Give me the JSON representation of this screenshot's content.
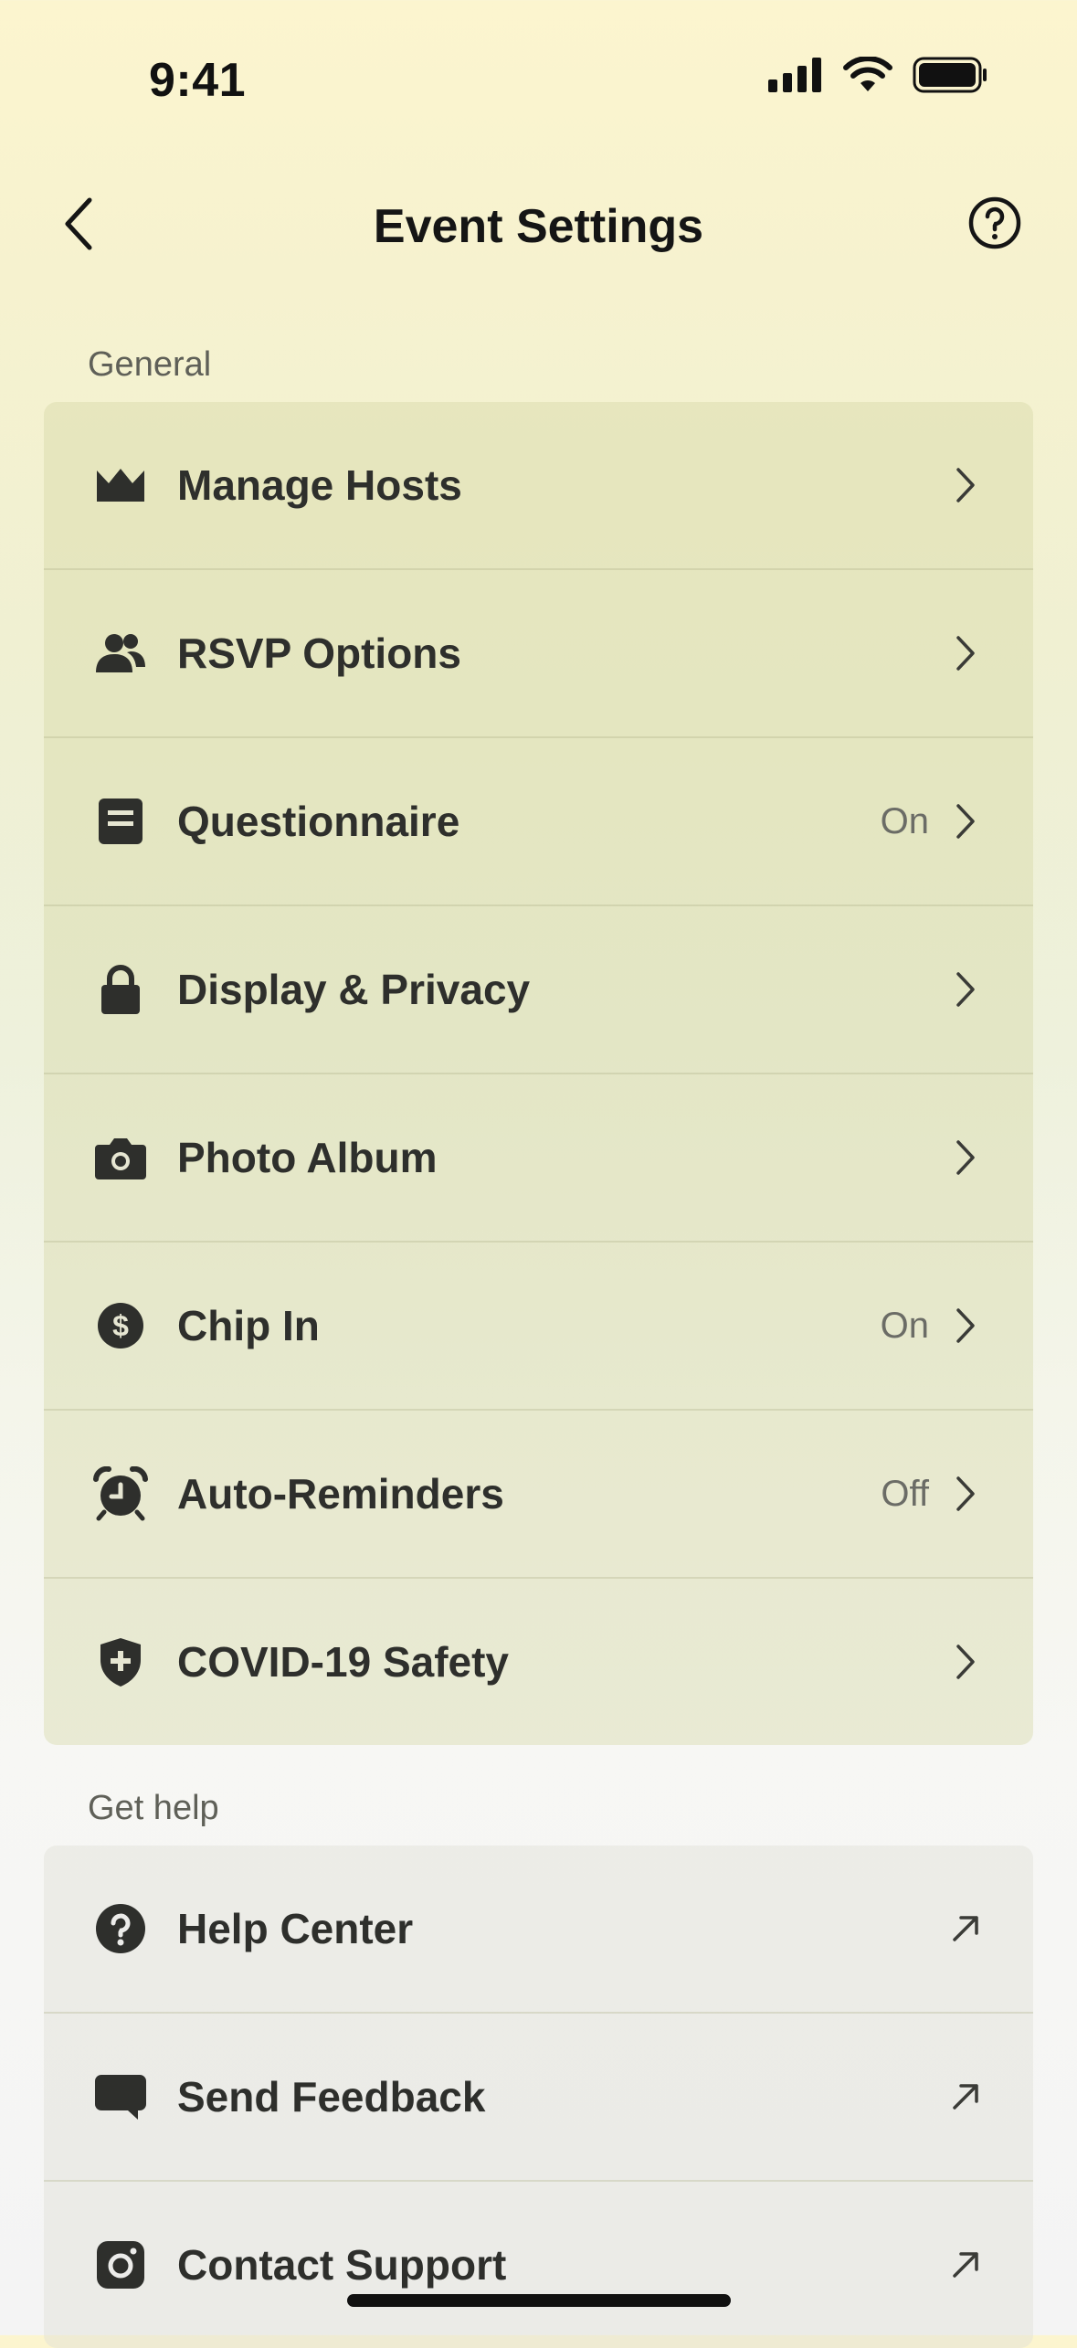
{
  "status_bar": {
    "time": "9:41"
  },
  "nav": {
    "title": "Event Settings"
  },
  "sections": {
    "general_label": "General",
    "help_label": "Get help"
  },
  "general_items": [
    {
      "label": "Manage Hosts",
      "value": "",
      "icon": "crown-icon"
    },
    {
      "label": "RSVP Options",
      "value": "",
      "icon": "people-icon"
    },
    {
      "label": "Questionnaire",
      "value": "On",
      "icon": "form-icon"
    },
    {
      "label": "Display & Privacy",
      "value": "",
      "icon": "lock-icon"
    },
    {
      "label": "Photo Album",
      "value": "",
      "icon": "camera-icon"
    },
    {
      "label": "Chip In",
      "value": "On",
      "icon": "dollar-icon"
    },
    {
      "label": "Auto-Reminders",
      "value": "Off",
      "icon": "alarm-icon"
    },
    {
      "label": "COVID-19 Safety",
      "value": "",
      "icon": "shield-icon"
    }
  ],
  "help_items": [
    {
      "label": "Help Center",
      "icon": "question-icon"
    },
    {
      "label": "Send Feedback",
      "icon": "chat-icon"
    },
    {
      "label": "Contact Support",
      "icon": "instagram-icon"
    }
  ]
}
